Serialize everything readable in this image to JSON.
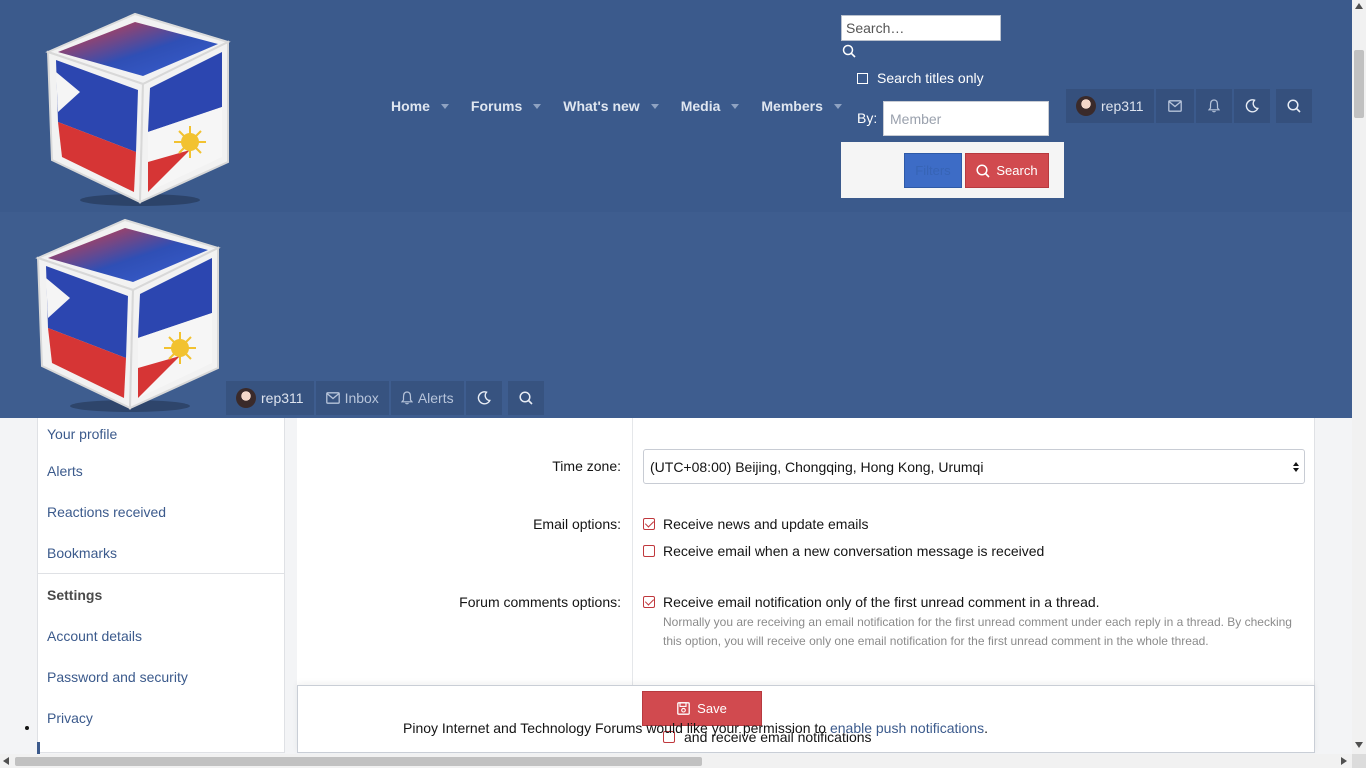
{
  "header": {
    "nav": [
      {
        "label": "Home"
      },
      {
        "label": "Forums"
      },
      {
        "label": "What's new"
      },
      {
        "label": "Media"
      },
      {
        "label": "Members"
      }
    ],
    "search_panel": {
      "placeholder": "Search…",
      "titles_only_label": "Search titles only",
      "by_label": "By:",
      "member_placeholder": "Member",
      "filters_label": "Filters",
      "search_label": "Search"
    },
    "user_nav_top": {
      "username": "rep311"
    },
    "user_nav_bottom": {
      "username": "rep311",
      "inbox_label": "Inbox",
      "alerts_label": "Alerts"
    }
  },
  "sidebar": {
    "items": [
      {
        "label": "Your profile"
      },
      {
        "label": "Alerts"
      },
      {
        "label": "Reactions received"
      },
      {
        "label": "Bookmarks"
      }
    ],
    "settings_header": "Settings",
    "settings_items": [
      {
        "label": "Account details"
      },
      {
        "label": "Password and security"
      },
      {
        "label": "Privacy"
      }
    ]
  },
  "form": {
    "timezone_label": "Time zone:",
    "timezone_value": "(UTC+08:00) Beijing, Chongqing, Hong Kong, Urumqi",
    "email_options_label": "Email options:",
    "email_options": [
      {
        "label": "Receive news and update emails",
        "checked": true
      },
      {
        "label": "Receive email when a new conversation message is received",
        "checked": false
      }
    ],
    "forum_comments_label": "Forum comments options:",
    "forum_comment_option": "Receive email notification only of the first unread comment in a thread.",
    "forum_comment_hint": "Normally you are receiving an email notification for the first unread comment under each reply in a thread. By checking this option, you will receive only one email notification for the first unread comment in the whole thread.",
    "save_label": "Save",
    "ghost_option": "and receive email notifications"
  },
  "push_notice": {
    "text": "Pinoy Internet and Technology Forums would like your permission to",
    "link": "enable push notifications",
    "suffix": "."
  },
  "colors": {
    "header_bg": "#3b5a8c",
    "accent_red": "#d14a4f",
    "link_blue": "#3b5a8c"
  }
}
